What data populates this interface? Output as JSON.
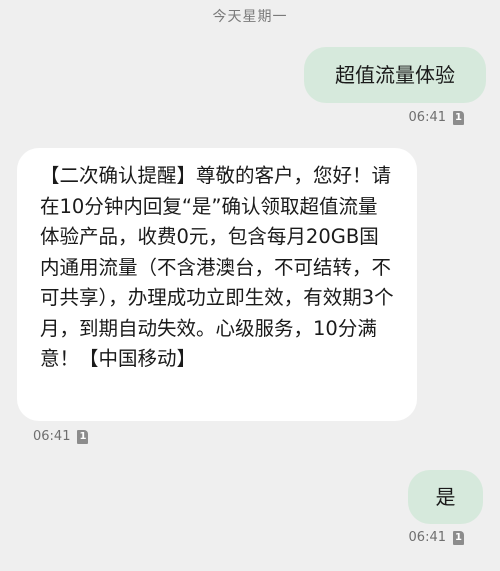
{
  "conversation": {
    "date_header": "今天星期一",
    "messages": [
      {
        "direction": "outgoing",
        "text": "超值流量体验",
        "time": "06:41",
        "sim": "1"
      },
      {
        "direction": "incoming",
        "text": "【二次确认提醒】尊敬的客户，您好！请在10分钟内回复“是”确认领取超值流量体验产品，收费0元，包含每月20GB国内通用流量（不含港澳台，不可结转，不可共享），办理成功立即生效，有效期3个月，到期自动失效。心级服务，10分满意！【中国移动】",
        "time": "06:41",
        "sim": "1"
      },
      {
        "direction": "outgoing",
        "text": "是",
        "time": "06:41",
        "sim": "1"
      }
    ]
  },
  "colors": {
    "background": "#efefef",
    "outgoing_bubble": "#d6e9dc",
    "incoming_bubble": "#ffffff"
  },
  "icons": {
    "sim_indicator": "sim-card-icon"
  }
}
